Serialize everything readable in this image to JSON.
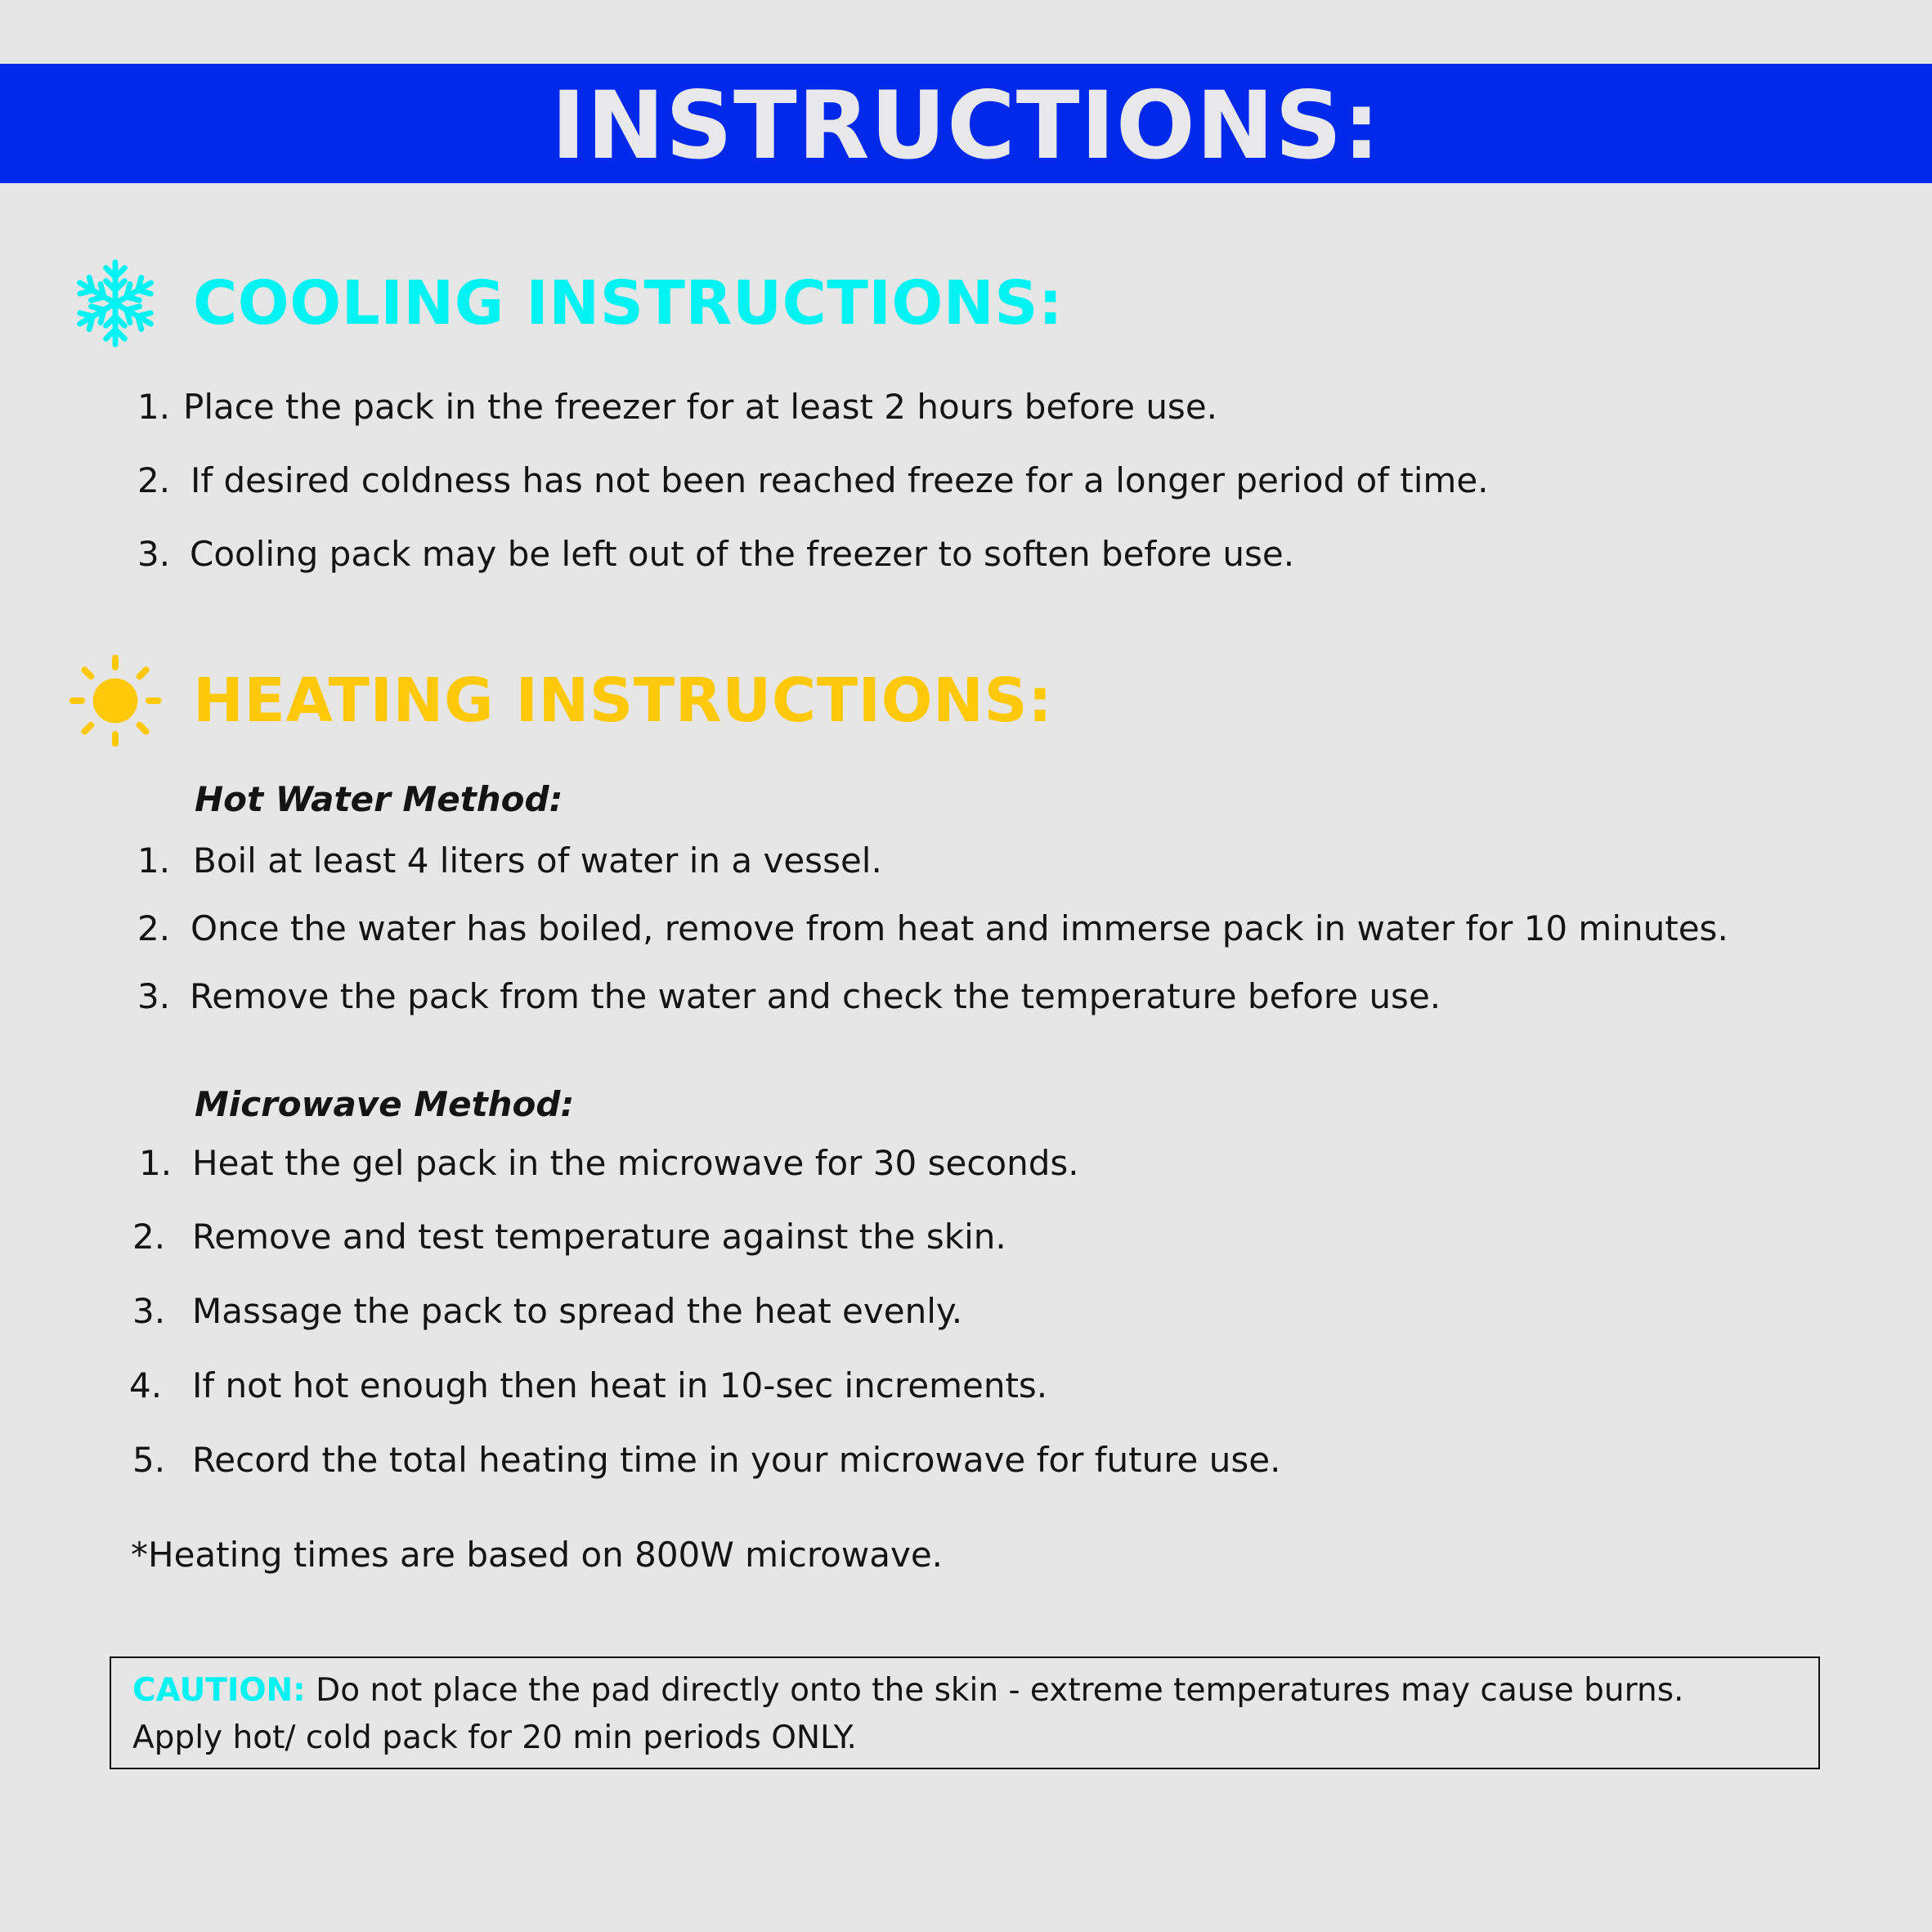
{
  "banner": {
    "title": "INSTRUCTIONS:",
    "background": "#0029ec"
  },
  "cooling": {
    "icon": "snowflake-icon",
    "title": "COOLING INSTRUCTIONS:",
    "color": "#00f2f2",
    "steps": [
      {
        "num": "1.",
        "text": "Place the pack in the freezer for at least 2 hours before use."
      },
      {
        "num": "2.",
        "text": "If desired coldness has not been reached freeze for a longer period of time."
      },
      {
        "num": "3.",
        "text": "Cooling pack may be left out of the freezer to soften before use."
      }
    ]
  },
  "heating": {
    "icon": "sun-icon",
    "title": "HEATING INSTRUCTIONS:",
    "color": "#ffc90a",
    "hot_water": {
      "label": "Hot Water Method:",
      "steps": [
        {
          "num": "1.",
          "text": "Boil at least 4 liters of water in a vessel."
        },
        {
          "num": "2.",
          "text": "Once the water has boiled, remove from heat and immerse pack in water for 10 minutes."
        },
        {
          "num": "3.",
          "text": "Remove the pack from the water and check the temperature before use."
        }
      ]
    },
    "microwave": {
      "label": "Microwave Method:",
      "steps": [
        {
          "num": "1.",
          "text": "Heat the gel pack in the microwave for 30 seconds."
        },
        {
          "num": "2.",
          "text": "Remove and test temperature against the skin."
        },
        {
          "num": "3.",
          "text": "Massage the pack to spread the heat evenly."
        },
        {
          "num": "4.",
          "text": "If not hot enough then heat in 10-sec increments."
        },
        {
          "num": "5.",
          "text": "Record the total heating time in your microwave for future use."
        }
      ]
    },
    "footnote": "*Heating times are based on 800W microwave."
  },
  "caution": {
    "label": "CAUTION:",
    "line1": " Do not place the pad directly onto the skin - extreme temperatures may cause burns.",
    "line2": "Apply hot/ cold pack for 20 min periods ONLY."
  }
}
